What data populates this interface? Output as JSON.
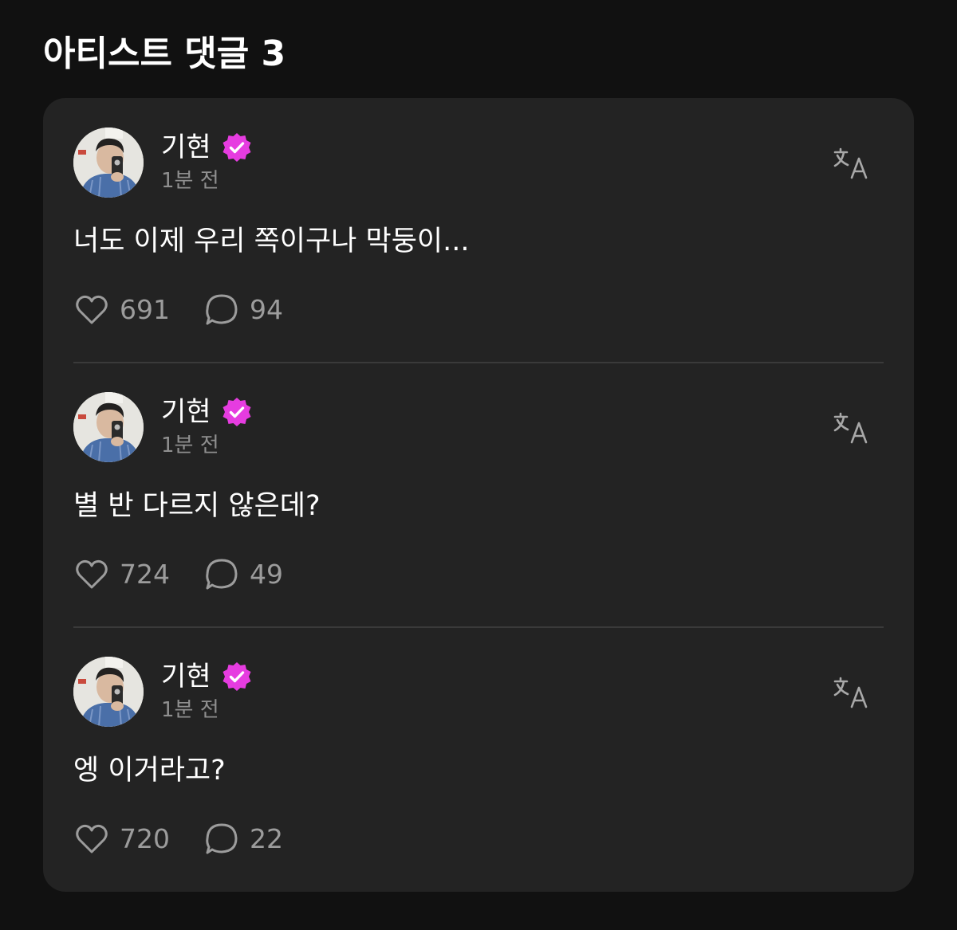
{
  "section": {
    "title": "아티스트 댓글 3"
  },
  "colors": {
    "background": "#111111",
    "card": "#232323",
    "verified_badge": "#e63ce0",
    "muted_text": "#8f8f8f",
    "icon": "#9c9c9c"
  },
  "comments": [
    {
      "author": "기현",
      "verified": true,
      "time": "1분 전",
      "text": "너도 이제 우리 쪽이구나 막둥이...",
      "likes": "691",
      "replies": "94"
    },
    {
      "author": "기현",
      "verified": true,
      "time": "1분 전",
      "text": "별 반 다르지 않은데?",
      "likes": "724",
      "replies": "49"
    },
    {
      "author": "기현",
      "verified": true,
      "time": "1분 전",
      "text": "엥 이거라고?",
      "likes": "720",
      "replies": "22"
    }
  ],
  "icons": {
    "verified": "verified-badge-icon",
    "translate": "translate-icon",
    "like": "heart-icon",
    "reply": "speech-bubble-icon"
  }
}
